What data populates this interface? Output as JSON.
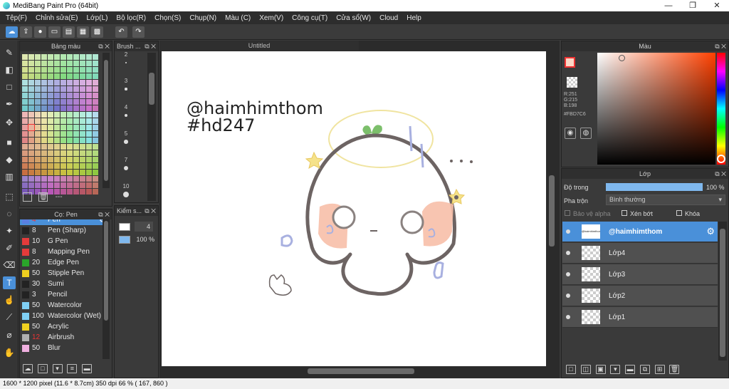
{
  "window": {
    "title": "MediBang Paint Pro (64bit)",
    "min": "—",
    "max": "❐",
    "close": "✕"
  },
  "menu": [
    "Tệp(F)",
    "Chỉnh sửa(E)",
    "Lớp(L)",
    "Bộ lọc(R)",
    "Chọn(S)",
    "Chụp(N)",
    "Màu (C)",
    "Xem(V)",
    "Công cụ(T)",
    "Cửa sổ(W)",
    "Cloud",
    "Help"
  ],
  "panels": {
    "palette": {
      "title": "Bảng màu",
      "footer_text": "---"
    },
    "brush_size": {
      "title": "Brush ...",
      "sizes": [
        "2",
        "3",
        "4",
        "5",
        "7",
        "10"
      ]
    },
    "brush_list": {
      "title": "Cọ: Pen",
      "items": [
        {
          "size": "4",
          "name": "Pen",
          "color": "#5a7fe0",
          "size_color": "#e33",
          "selected": true
        },
        {
          "size": "8",
          "name": "Pen (Sharp)",
          "color": "#222222"
        },
        {
          "size": "10",
          "name": "G Pen",
          "color": "#e33b3b"
        },
        {
          "size": "8",
          "name": "Mapping Pen",
          "color": "#e33b3b"
        },
        {
          "size": "20",
          "name": "Edge Pen",
          "color": "#2aa52a"
        },
        {
          "size": "50",
          "name": "Stipple Pen",
          "color": "#f0d020"
        },
        {
          "size": "30",
          "name": "Sumi",
          "color": "#222222"
        },
        {
          "size": "3",
          "name": "Pencil",
          "color": "#222222"
        },
        {
          "size": "50",
          "name": "Watercolor",
          "color": "#7fd0f5"
        },
        {
          "size": "100",
          "name": "Watercolor (Wet)",
          "color": "#7fd0f5"
        },
        {
          "size": "50",
          "name": "Acrylic",
          "color": "#f0d020"
        },
        {
          "size": "12",
          "name": "Airbrush",
          "color": "#b0b0b0",
          "size_color": "#e33"
        },
        {
          "size": "50",
          "name": "Blur",
          "color": "#f0b0e0"
        }
      ]
    },
    "kiem_soat": {
      "title": "Kiểm s...",
      "value_top": "4",
      "value_bottom": "100 %"
    },
    "color": {
      "title": "Màu",
      "r": "R:251",
      "g": "G:215",
      "b": "B:198",
      "hex": "#FBD7C6",
      "current": "#fbd7c6"
    },
    "layers": {
      "title": "Lớp",
      "opacity_label": "Độ trong",
      "opacity_value": "100 %",
      "opacity": 1.0,
      "blend_label": "Pha trộn",
      "blend_value": "Bình thường",
      "protect_alpha": "Bảo vệ alpha",
      "clip": "Xén bớt",
      "lock": "Khóa",
      "items": [
        {
          "name": "@haimhimthom",
          "selected": true,
          "text_thumb": "@haimhimthom"
        },
        {
          "name": "Lớp4"
        },
        {
          "name": "Lớp3"
        },
        {
          "name": "Lớp2"
        },
        {
          "name": "Lớp1"
        }
      ]
    }
  },
  "canvas": {
    "tab_title": "Untitled",
    "text_line1": "@haimhimthom",
    "text_line2": "#hd247"
  },
  "status": {
    "text": "1600 * 1200 pixel   (11.6 * 8.7cm)   350 dpi   66 %   ( 167, 860 )"
  }
}
